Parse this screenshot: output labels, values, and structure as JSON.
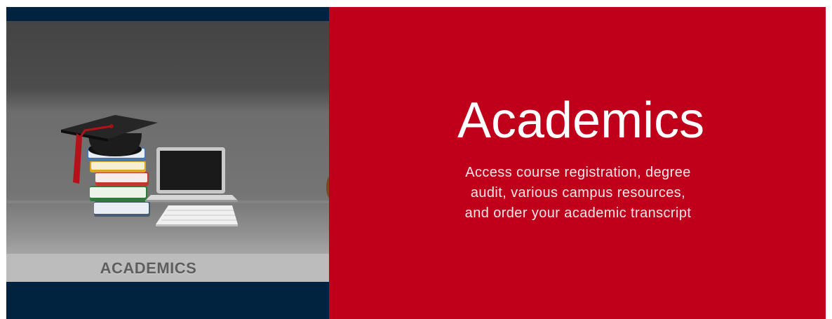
{
  "banner": {
    "image": {
      "label": "ACADEMICS",
      "icons": [
        "graduation-cap-icon",
        "book-stack-icon",
        "laptop-icon",
        "keyboard-icon"
      ]
    },
    "promo": {
      "title": "Academics",
      "description": "Access course registration, degree\naudit, various campus resources,\nand  order your academic transcript"
    }
  },
  "colors": {
    "navy": "#01233f",
    "red": "#c0001a",
    "white": "#ffffff"
  }
}
